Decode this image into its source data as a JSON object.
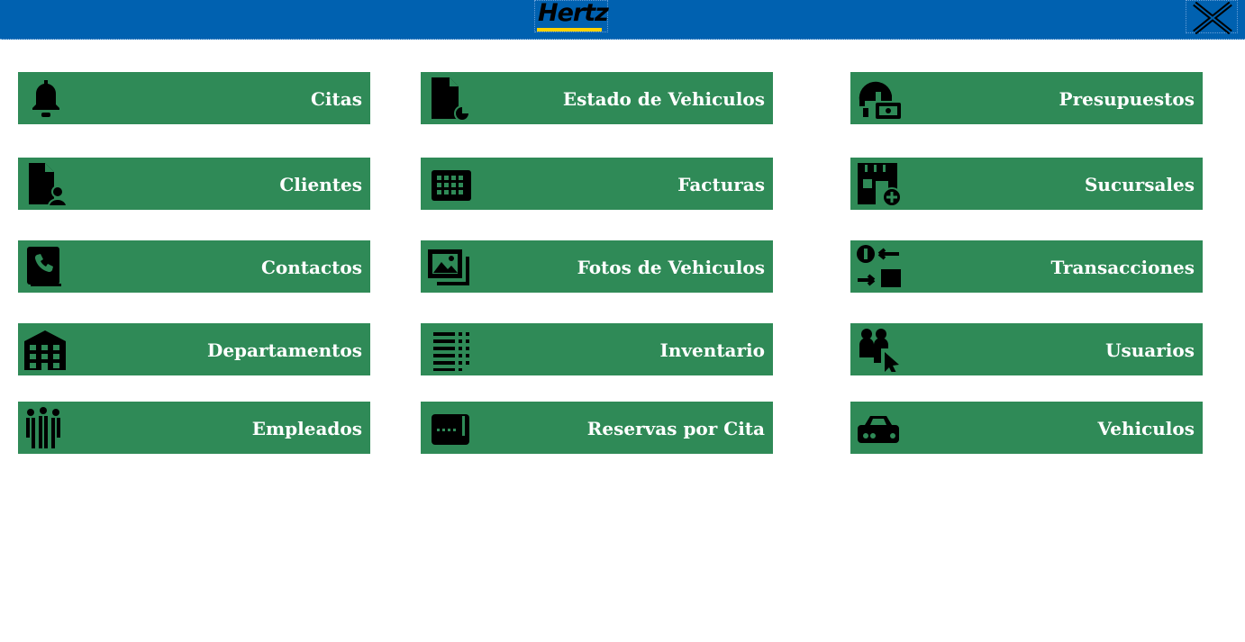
{
  "header": {
    "logo_text": "Hertz",
    "close_icon": "close-x-icon",
    "bar_color": "#0061b0",
    "logo_accent": "#ffd200"
  },
  "menu": {
    "tile_color": "#2f8a57",
    "items": [
      {
        "label": "Citas",
        "icon": "bell-icon"
      },
      {
        "label": "Estado de Vehiculos",
        "icon": "document-status-icon"
      },
      {
        "label": "Presupuestos",
        "icon": "budget-helmet-icon"
      },
      {
        "label": "Clientes",
        "icon": "client-document-icon"
      },
      {
        "label": "Facturas",
        "icon": "invoice-grid-icon"
      },
      {
        "label": "Sucursales",
        "icon": "store-add-icon"
      },
      {
        "label": "Contactos",
        "icon": "phone-book-icon"
      },
      {
        "label": "Fotos de Vehiculos",
        "icon": "photo-gallery-icon"
      },
      {
        "label": "Transacciones",
        "icon": "transactions-icon"
      },
      {
        "label": "Departamentos",
        "icon": "building-icon"
      },
      {
        "label": "Inventario",
        "icon": "inventory-list-icon"
      },
      {
        "label": "Usuarios",
        "icon": "users-cursor-icon"
      },
      {
        "label": "Empleados",
        "icon": "employees-icon"
      },
      {
        "label": "Reservas por Cita",
        "icon": "card-icon"
      },
      {
        "label": "Vehiculos",
        "icon": "car-icon"
      }
    ]
  }
}
